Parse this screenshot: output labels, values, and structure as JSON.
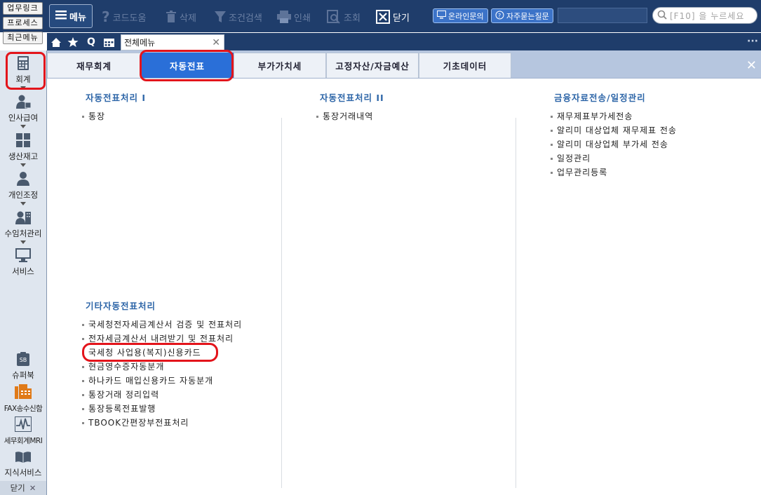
{
  "quick_links": [
    "업무링크",
    "프로세스",
    "최근메뉴"
  ],
  "toolbar": {
    "menu": "메뉴",
    "items": [
      "코드도움",
      "삭제",
      "조건검색",
      "인쇄",
      "조회"
    ],
    "close": "닫기",
    "inquiry": "온라인문의",
    "faq": "자주묻는질문",
    "search_placeholder": "[F10] 을 누르세요"
  },
  "tabstrip": {
    "doc_tab": "전체메뉴",
    "q_icon": "Q"
  },
  "sidebar": {
    "items": [
      "회계",
      "인사급여",
      "생산재고",
      "개인조정",
      "수임처관리",
      "서비스"
    ],
    "bottom_items": [
      "슈퍼북",
      "FAX송수신함",
      "세무회계MRI",
      "지식서비스"
    ],
    "super_book_badge": "SB",
    "close": "닫기"
  },
  "categories": [
    "재무회계",
    "자동전표",
    "부가가치세",
    "고정자산/자금예산",
    "기초데이터"
  ],
  "active_category": "자동전표",
  "sections": {
    "col1_title": "자동전표처리 I",
    "col1_items": [
      "통장"
    ],
    "col2_title": "자동전표처리 II",
    "col2_items": [
      "통장거래내역"
    ],
    "col3_title": "금융자료전송/일정관리",
    "col3_items": [
      "재무제표부가세전송",
      "알리미 대상업체 재무제표 전송",
      "알리미 대상업체 부가세 전송",
      "일정관리",
      "업무관리등록"
    ],
    "other_title": "기타자동전표처리",
    "other_items": [
      "국세청전자세금계산서 검증 및 전표처리",
      "전자세금계산서 내려받기 및 전표처리",
      "국세청 사업용(복지)신용카드",
      "현금영수증자동분개",
      "하나카드 매입신용카드 자동분개",
      "통장거래 정리입력",
      "통장등록전표발행",
      "TBOOK간편장부전표처리"
    ]
  }
}
